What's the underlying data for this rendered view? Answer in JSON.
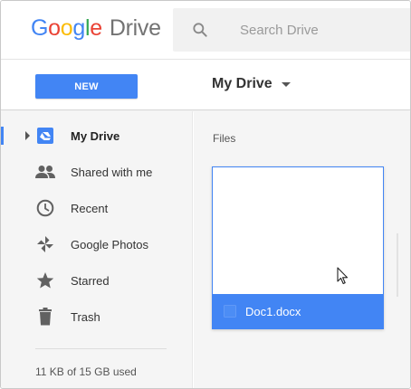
{
  "header": {
    "logo_letters": [
      "G",
      "o",
      "o",
      "g",
      "l",
      "e"
    ],
    "product_name": "Drive",
    "search": {
      "placeholder": "Search Drive"
    }
  },
  "toolbar": {
    "new_label": "NEW",
    "location_label": "My Drive"
  },
  "sidebar": {
    "items": [
      {
        "label": "My Drive",
        "icon": "my-drive-icon",
        "active": true
      },
      {
        "label": "Shared with me",
        "icon": "people-icon",
        "active": false
      },
      {
        "label": "Recent",
        "icon": "clock-icon",
        "active": false
      },
      {
        "label": "Google Photos",
        "icon": "pinwheel-icon",
        "active": false
      },
      {
        "label": "Starred",
        "icon": "star-icon",
        "active": false
      },
      {
        "label": "Trash",
        "icon": "trash-icon",
        "active": false
      }
    ],
    "storage_text": "11 KB of 15 GB used"
  },
  "main": {
    "section_heading": "Files",
    "files": [
      {
        "name": "Doc1.docx",
        "selected": true
      }
    ]
  },
  "colors": {
    "accent": "#4285f4",
    "sidebar_bg": "#f5f5f5",
    "icon_gray": "#616161"
  }
}
